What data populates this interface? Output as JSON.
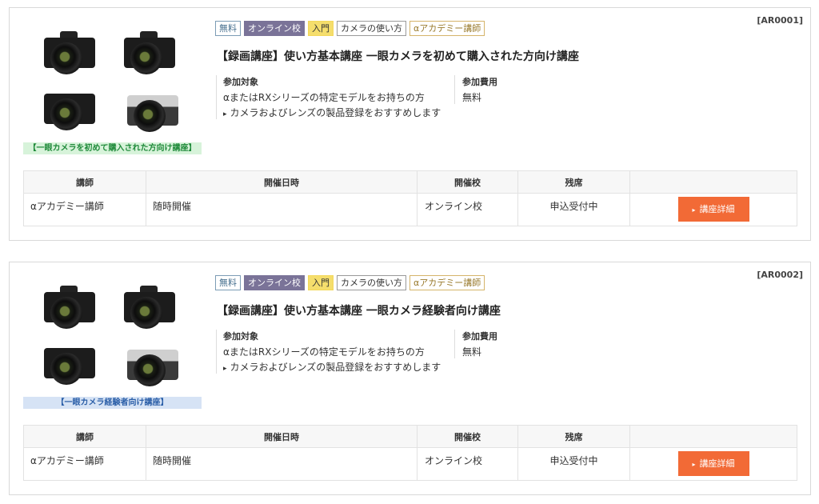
{
  "courses": [
    {
      "code": "[AR0001]",
      "image_caption": "【一眼カメラを初めて購入された方向け講座】",
      "tags": [
        "無料",
        "オンライン校",
        "入門",
        "カメラの使い方",
        "αアカデミー講師"
      ],
      "title": "【録画講座】使い方基本講座 一眼カメラを初めて購入された方向け講座",
      "target_heading": "参加対象",
      "target_text": "αまたはRXシリーズの特定モデルをお持ちの方",
      "target_note": "カメラおよびレンズの製品登録をおすすめします",
      "fee_heading": "参加費用",
      "fee_value": "無料",
      "table_headers": [
        "講師",
        "開催日時",
        "開催校",
        "残席",
        ""
      ],
      "row": {
        "instructor": "αアカデミー講師",
        "datetime": "随時開催",
        "school": "オンライン校",
        "seats": "申込受付中",
        "button": "講座詳細"
      }
    },
    {
      "code": "[AR0002]",
      "image_caption": "【一眼カメラ経験者向け講座】",
      "tags": [
        "無料",
        "オンライン校",
        "入門",
        "カメラの使い方",
        "αアカデミー講師"
      ],
      "title": "【録画講座】使い方基本講座 一眼カメラ経験者向け講座",
      "target_heading": "参加対象",
      "target_text": "αまたはRXシリーズの特定モデルをお持ちの方",
      "target_note": "カメラおよびレンズの製品登録をおすすめします",
      "fee_heading": "参加費用",
      "fee_value": "無料",
      "table_headers": [
        "講師",
        "開催日時",
        "開催校",
        "残席",
        ""
      ],
      "row": {
        "instructor": "αアカデミー講師",
        "datetime": "随時開催",
        "school": "オンライン校",
        "seats": "申込受付中",
        "button": "講座詳細"
      }
    }
  ],
  "colors": {
    "button": "#f26a36",
    "tag_online": "#7a7398",
    "tag_beginner": "#f5de6c",
    "caption_green": "#d7f3da",
    "caption_blue": "#d6e3f5"
  },
  "icons": [
    "camera-image",
    "play-triangle-icon"
  ]
}
